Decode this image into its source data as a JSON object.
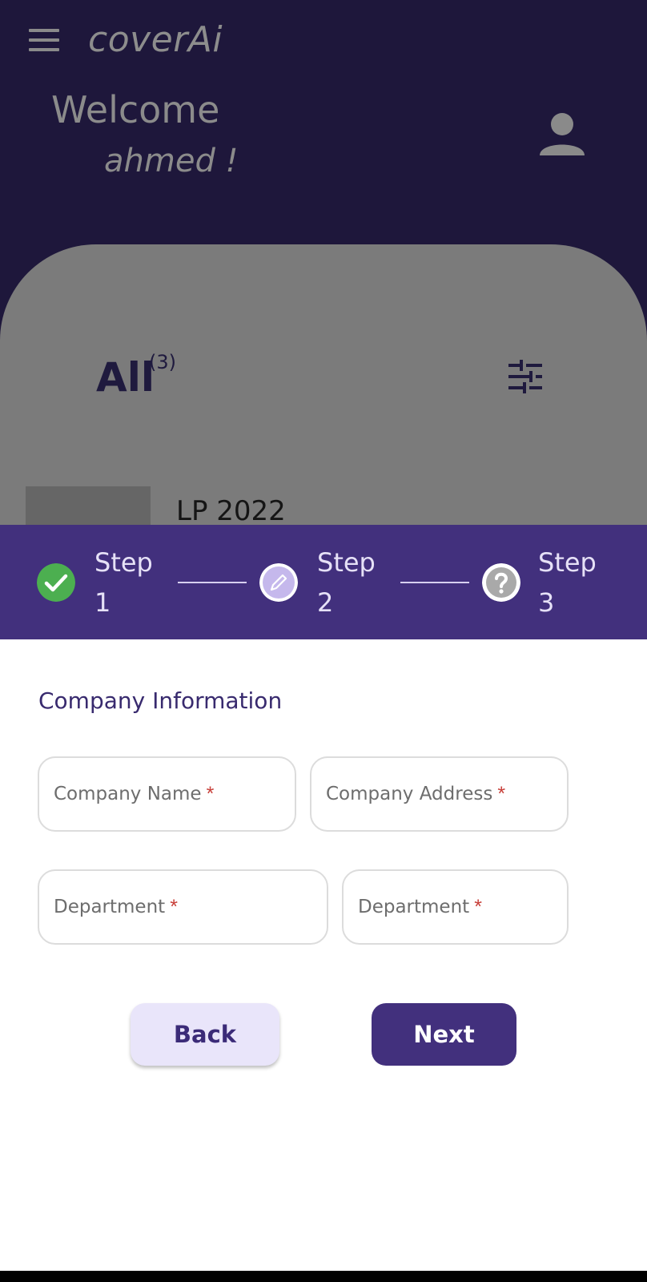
{
  "app": {
    "title": "coverAi",
    "welcome": "Welcome",
    "username": "ahmed !"
  },
  "list": {
    "filter_label": "All",
    "filter_count": "(3)",
    "first_item_title": "LP 2022"
  },
  "stepper": {
    "steps": [
      {
        "label": "Step 1",
        "state": "completed",
        "icon": "check-circle-icon"
      },
      {
        "label": "Step 2",
        "state": "editing",
        "icon": "pencil-icon"
      },
      {
        "label": "Step 3",
        "state": "pending",
        "icon": "question-circle-icon"
      }
    ]
  },
  "form": {
    "section_title": "Company Information",
    "fields": [
      {
        "placeholder": "Company Name",
        "required_mark": "*"
      },
      {
        "placeholder": "Company Address",
        "required_mark": "*"
      },
      {
        "placeholder": "Department",
        "required_mark": "*"
      },
      {
        "placeholder": "Department",
        "required_mark": "*"
      }
    ]
  },
  "actions": {
    "back_label": "Back",
    "next_label": "Next"
  },
  "colors": {
    "header_bg": "#1e173b",
    "accent": "#42307d",
    "success": "#4caf50",
    "required": "#c8403a"
  }
}
